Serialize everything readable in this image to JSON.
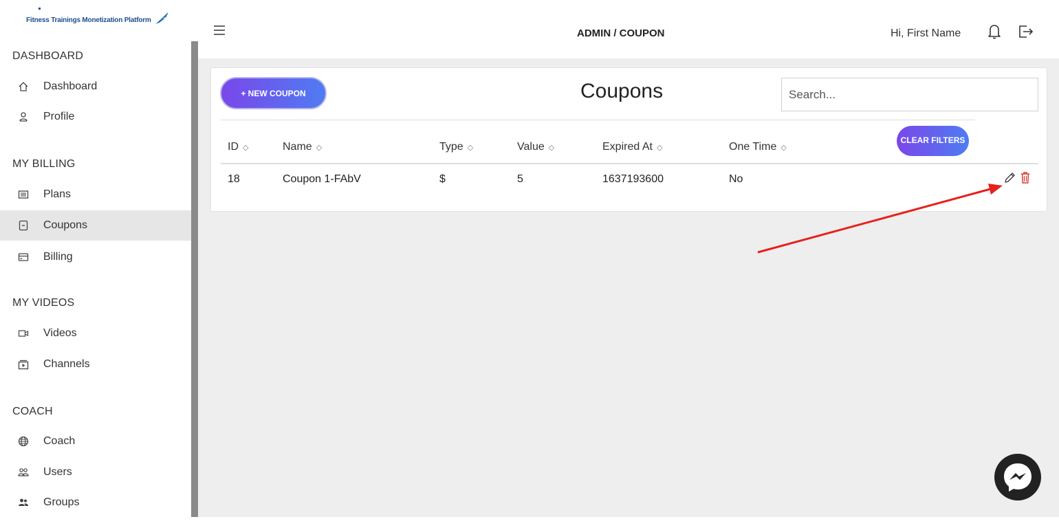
{
  "brand": {
    "text": "Fitness Trainings Monetization Platform"
  },
  "sidebar": {
    "sections": [
      {
        "title": "DASHBOARD",
        "items": [
          {
            "label": "Dashboard",
            "icon": "home-icon"
          },
          {
            "label": "Profile",
            "icon": "user-icon"
          }
        ]
      },
      {
        "title": "MY BILLING",
        "items": [
          {
            "label": "Plans",
            "icon": "list-icon"
          },
          {
            "label": "Coupons",
            "icon": "coupon-icon",
            "active": true
          },
          {
            "label": "Billing",
            "icon": "credit-card-icon"
          }
        ]
      },
      {
        "title": "MY VIDEOS",
        "items": [
          {
            "label": "Videos",
            "icon": "video-icon"
          },
          {
            "label": "Channels",
            "icon": "channel-icon"
          }
        ]
      },
      {
        "title": "COACH",
        "items": [
          {
            "label": "Coach",
            "icon": "globe-icon"
          },
          {
            "label": "Users",
            "icon": "users-icon"
          },
          {
            "label": "Groups",
            "icon": "group-icon"
          }
        ]
      }
    ]
  },
  "header": {
    "title": "ADMIN / COUPON",
    "greeting": "Hi, First Name"
  },
  "main": {
    "title": "Coupons",
    "new_button": "+ NEW COUPON",
    "clear_button": "CLEAR FILTERS",
    "search": {
      "placeholder": "Search...",
      "value": ""
    },
    "table": {
      "columns": [
        "ID",
        "Name",
        "Type",
        "Value",
        "Expired At",
        "One Time"
      ],
      "rows": [
        [
          "18",
          "Coupon 1-FAbV",
          "$",
          "5",
          "1637193600",
          "No"
        ]
      ]
    }
  },
  "colors": {
    "accent_start": "#7a47ea",
    "accent_end": "#4f7cf2",
    "delete": "#d9342b",
    "annotation_arrow": "#e8201c"
  }
}
